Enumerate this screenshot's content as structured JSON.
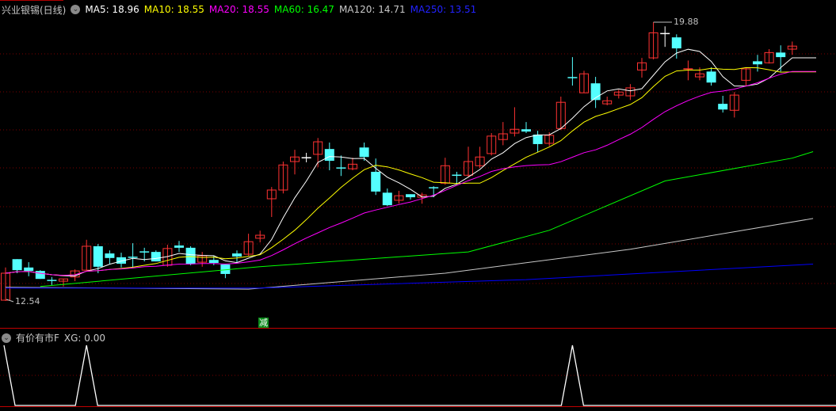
{
  "header": {
    "title": "兴业银锡(日线)",
    "ma_items": [
      {
        "label": "MA5: 18.96",
        "color": "#ffffff"
      },
      {
        "label": "MA10: 18.55",
        "color": "#ffff00"
      },
      {
        "label": "MA20: 18.55",
        "color": "#ff00ff"
      },
      {
        "label": "MA60: 16.47",
        "color": "#00ff00"
      },
      {
        "label": "MA120: 14.71",
        "color": "#c8c8c8"
      },
      {
        "label": "MA250: 13.51",
        "color": "#0000ff"
      }
    ]
  },
  "main_chart": {
    "low_label": "12.54",
    "high_label": "19.88",
    "signal_badge": "减",
    "signal_index": 22,
    "price_range": [
      12.54,
      19.88
    ],
    "colors": {
      "up": "#ff3232",
      "down": "#54ffff",
      "cross": "#ffffff",
      "grid": "#7a0000"
    },
    "candles": [
      [
        12.56,
        13.27,
        13.42,
        12.54
      ],
      [
        13.64,
        13.35,
        13.64,
        13.27
      ],
      [
        13.42,
        13.33,
        13.56,
        13.19
      ],
      [
        13.33,
        13.12,
        13.35,
        13.12
      ],
      [
        13.08,
        13.08,
        13.17,
        12.96
      ],
      [
        13.06,
        13.12,
        13.12,
        12.92
      ],
      [
        13.17,
        13.33,
        13.37,
        13.06
      ],
      [
        13.35,
        13.98,
        14.15,
        13.35
      ],
      [
        13.98,
        13.44,
        14.04,
        13.27
      ],
      [
        13.79,
        13.67,
        13.87,
        13.52
      ],
      [
        13.69,
        13.52,
        13.81,
        13.42
      ],
      [
        13.69,
        13.69,
        14.06,
        13.42
      ],
      [
        13.83,
        13.83,
        13.94,
        13.58
      ],
      [
        13.83,
        13.58,
        13.87,
        13.58
      ],
      [
        13.48,
        13.92,
        14.02,
        13.44
      ],
      [
        14.0,
        13.94,
        14.12,
        13.83
      ],
      [
        13.94,
        13.52,
        13.98,
        13.48
      ],
      [
        13.56,
        13.73,
        13.83,
        13.44
      ],
      [
        13.62,
        13.54,
        13.73,
        13.48
      ],
      [
        13.5,
        13.25,
        13.5,
        13.14
      ],
      [
        13.79,
        13.71,
        13.87,
        13.54
      ],
      [
        13.77,
        14.1,
        14.31,
        13.73
      ],
      [
        14.19,
        14.27,
        14.39,
        14.08
      ],
      [
        15.23,
        15.46,
        15.54,
        14.75
      ],
      [
        15.46,
        16.12,
        16.21,
        15.37
      ],
      [
        16.21,
        16.33,
        16.52,
        15.87
      ],
      [
        16.31,
        16.31,
        16.44,
        16.19
      ],
      [
        16.4,
        16.73,
        16.83,
        16.06
      ],
      [
        16.54,
        16.23,
        16.71,
        15.98
      ],
      [
        16.04,
        16.04,
        16.37,
        15.83
      ],
      [
        16.02,
        16.14,
        16.31,
        15.98
      ],
      [
        16.58,
        16.33,
        16.71,
        16.23
      ],
      [
        15.94,
        15.42,
        16.29,
        15.33
      ],
      [
        15.39,
        15.06,
        15.5,
        15.04
      ],
      [
        15.19,
        15.31,
        15.44,
        15.1
      ],
      [
        15.35,
        15.27,
        15.35,
        15.21
      ],
      [
        15.27,
        15.33,
        15.39,
        15.1
      ],
      [
        15.52,
        15.52,
        15.56,
        15.27
      ],
      [
        15.64,
        16.1,
        16.31,
        15.6
      ],
      [
        15.85,
        15.85,
        15.94,
        15.62
      ],
      [
        15.85,
        16.21,
        16.6,
        15.79
      ],
      [
        16.1,
        16.33,
        16.6,
        16.04
      ],
      [
        16.42,
        16.88,
        16.96,
        16.37
      ],
      [
        16.79,
        16.94,
        17.25,
        16.64
      ],
      [
        16.96,
        17.06,
        17.64,
        16.87
      ],
      [
        17.06,
        17.0,
        17.25,
        16.96
      ],
      [
        16.92,
        16.67,
        17.02,
        16.46
      ],
      [
        16.69,
        16.9,
        16.98,
        16.62
      ],
      [
        17.08,
        17.77,
        17.92,
        17.04
      ],
      [
        18.42,
        18.42,
        18.96,
        18.21
      ],
      [
        18.02,
        18.52,
        18.6,
        18.02
      ],
      [
        18.27,
        17.83,
        18.44,
        17.62
      ],
      [
        17.73,
        17.81,
        17.92,
        17.69
      ],
      [
        17.96,
        18.04,
        18.1,
        17.87
      ],
      [
        17.94,
        18.15,
        18.25,
        17.83
      ],
      [
        18.62,
        18.81,
        18.94,
        18.42
      ],
      [
        18.94,
        19.6,
        19.88,
        18.9
      ],
      [
        19.58,
        19.58,
        19.77,
        19.23
      ],
      [
        19.48,
        19.19,
        19.56,
        18.92
      ],
      [
        18.65,
        18.65,
        18.87,
        18.35
      ],
      [
        18.44,
        18.52,
        18.69,
        18.35
      ],
      [
        18.58,
        18.29,
        18.69,
        18.21
      ],
      [
        17.73,
        17.58,
        17.94,
        17.5
      ],
      [
        17.56,
        17.96,
        18.04,
        17.37
      ],
      [
        18.35,
        18.65,
        18.67,
        18.21
      ],
      [
        18.85,
        18.77,
        19.02,
        18.58
      ],
      [
        18.81,
        19.08,
        19.17,
        18.79
      ],
      [
        19.08,
        18.96,
        19.27,
        18.58
      ],
      [
        19.17,
        19.25,
        19.37,
        19.02
      ]
    ],
    "long_ma": [
      {
        "name": "MA60",
        "color": "#00ff00",
        "points": [
          [
            3,
            12.92
          ],
          [
            22,
            13.44
          ],
          [
            40,
            13.83
          ],
          [
            47,
            14.4
          ],
          [
            57,
            15.7
          ],
          [
            68,
            16.3
          ],
          [
            69.8,
            16.47
          ]
        ]
      },
      {
        "name": "MA120",
        "color": "#c8c8c8",
        "points": [
          [
            0,
            12.9
          ],
          [
            21,
            12.85
          ],
          [
            38,
            13.27
          ],
          [
            54,
            13.9
          ],
          [
            69.8,
            14.71
          ]
        ]
      },
      {
        "name": "MA250",
        "color": "#0000ff",
        "points": [
          [
            0,
            12.88
          ],
          [
            22,
            12.88
          ],
          [
            45,
            13.1
          ],
          [
            69.8,
            13.51
          ]
        ]
      }
    ]
  },
  "sub_chart": {
    "title": "有价有市F",
    "xg_label": "XG: 0.00",
    "signal_indices": [
      0,
      7,
      49
    ]
  }
}
